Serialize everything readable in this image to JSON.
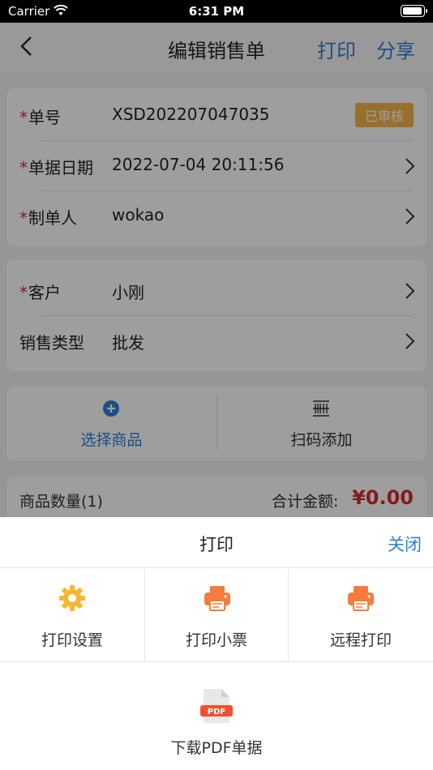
{
  "status_bar": {
    "carrier": "Carrier",
    "time": "6:31 PM"
  },
  "nav": {
    "title": "编辑销售单",
    "print": "打印",
    "share": "分享"
  },
  "order": {
    "number_label": "单号",
    "number_value": "XSD202207047035",
    "status_badge": "已审核",
    "date_label": "单据日期",
    "date_value": "2022-07-04 20:11:56",
    "maker_label": "制单人",
    "maker_value": "wokao"
  },
  "customer": {
    "customer_label": "客户",
    "customer_value": "小刚",
    "sale_type_label": "销售类型",
    "sale_type_value": "批发"
  },
  "actions": {
    "select_goods": "选择商品",
    "scan_add": "扫码添加"
  },
  "summary": {
    "count_label": "商品数量(1)",
    "total_label": "合计金额:",
    "total_value": "¥0.00"
  },
  "required_mark": "*",
  "sheet": {
    "title": "打印",
    "close": "关闭",
    "options": [
      "打印设置",
      "打印小票",
      "远程打印"
    ],
    "pdf_label": "下载PDF单据",
    "pdf_icon_text": "PDF"
  },
  "colors": {
    "accent": "#2f7fd6",
    "required": "#d0302a",
    "badge": "#f4b54a",
    "printer": "#f57c3d",
    "gear": "#f7b733"
  },
  "icons": [
    "back-chevron-icon",
    "chevron-right-icon",
    "plus-circle-icon",
    "barcode-scan-icon",
    "gear-icon",
    "printer-icon",
    "pdf-file-icon",
    "wifi-icon",
    "battery-icon"
  ]
}
